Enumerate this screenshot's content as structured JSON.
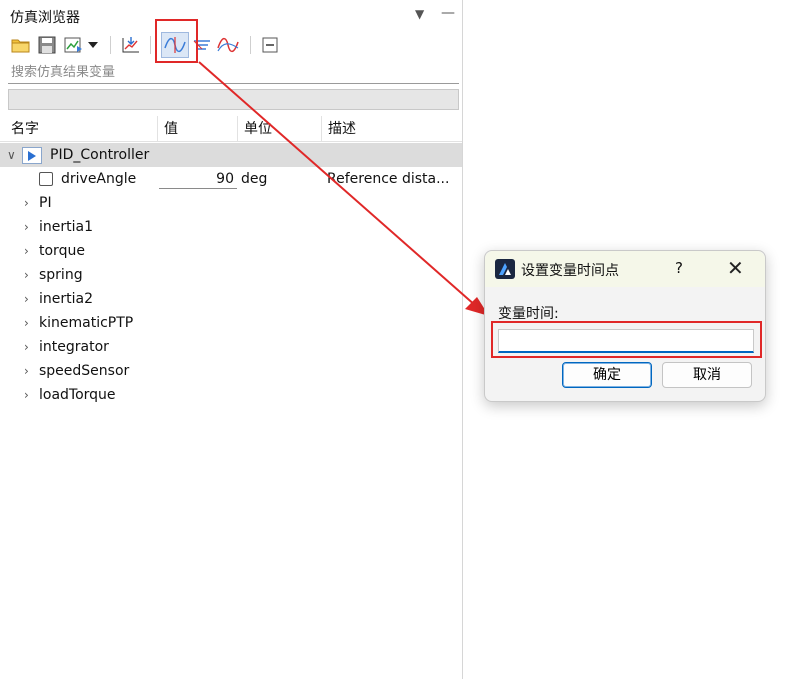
{
  "panel": {
    "title": "仿真浏览器",
    "search_placeholder": "搜索仿真结果变量",
    "columns": [
      "名字",
      "值",
      "单位",
      "描述"
    ],
    "tree": {
      "root_label": "PID_Controller",
      "child": {
        "name": "driveAngle",
        "value": "90",
        "unit": "deg",
        "description": "Reference dista..."
      },
      "items": [
        "PI",
        "inertia1",
        "torque",
        "spring",
        "inertia2",
        "kinematicPTP",
        "integrator",
        "speedSensor",
        "loadTorque"
      ]
    }
  },
  "dialog": {
    "title": "设置变量时间点",
    "help": "?",
    "close": "✕",
    "field_label": "变量时间:",
    "field_value": "",
    "ok_label": "确定",
    "cancel_label": "取消"
  },
  "colors": {
    "highlight": "#e02828",
    "accent": "#0067c0"
  }
}
